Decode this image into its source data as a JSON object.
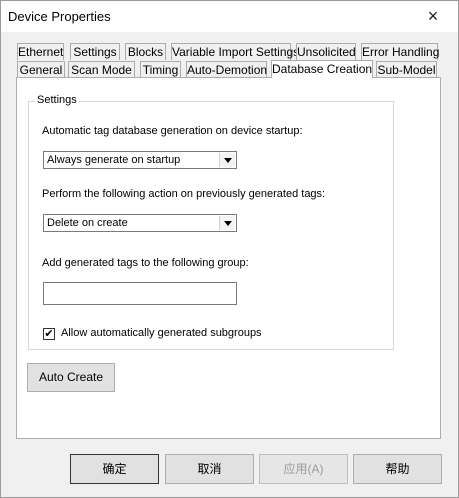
{
  "window": {
    "title": "Device Properties",
    "close_icon": "×"
  },
  "tabs_row1": [
    {
      "label": "Ethernet"
    },
    {
      "label": "Settings"
    },
    {
      "label": "Blocks"
    },
    {
      "label": "Variable Import Settings"
    },
    {
      "label": "Unsolicited"
    },
    {
      "label": "Error Handling"
    }
  ],
  "tabs_row2": [
    {
      "label": "General"
    },
    {
      "label": "Scan Mode"
    },
    {
      "label": "Timing"
    },
    {
      "label": "Auto-Demotion"
    },
    {
      "label": "Database Creation",
      "active": true
    },
    {
      "label": "Sub-Model"
    }
  ],
  "settings": {
    "legend": "Settings",
    "generation_label": "Automatic tag database generation on device startup:",
    "generation_value": "Always generate on startup",
    "action_label": "Perform the following action on previously generated tags:",
    "action_value": "Delete on create",
    "group_label": "Add generated tags to the following group:",
    "group_value": "",
    "subgroups_label": "Allow automatically generated subgroups",
    "subgroups_checked": true,
    "check_mark": "✔"
  },
  "auto_create_label": "Auto Create",
  "buttons": {
    "ok": "确定",
    "cancel": "取消",
    "apply": "应用(A)",
    "help": "帮助"
  }
}
